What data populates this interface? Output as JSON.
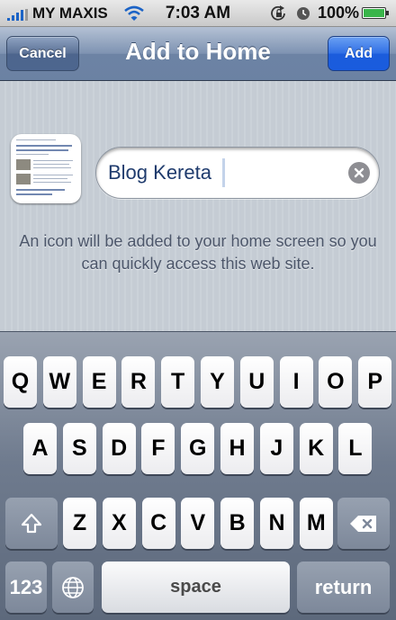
{
  "status_bar": {
    "carrier": "MY MAXIS",
    "time": "7:03 AM",
    "battery": "100%",
    "battery_level": 1.0
  },
  "nav": {
    "title": "Add to Home",
    "cancel_label": "Cancel",
    "add_label": "Add"
  },
  "form": {
    "name_value": "Blog Kereta",
    "hint": "An icon will be added to your home screen so you can quickly access this web site."
  },
  "keyboard": {
    "row1": [
      "Q",
      "W",
      "E",
      "R",
      "T",
      "Y",
      "U",
      "I",
      "O",
      "P"
    ],
    "row2": [
      "A",
      "S",
      "D",
      "F",
      "G",
      "H",
      "J",
      "K",
      "L"
    ],
    "row3": [
      "Z",
      "X",
      "C",
      "V",
      "B",
      "N",
      "M"
    ],
    "numbers_label": "123",
    "space_label": "space",
    "return_label": "return"
  },
  "colors": {
    "accent": "#1a5cde",
    "navbar": "#6d83a4",
    "battery": "#39b54a"
  },
  "icons": [
    "wifi-icon",
    "rotation-lock-icon",
    "alarm-icon",
    "battery-icon",
    "clear-icon",
    "shift-icon",
    "backspace-icon",
    "globe-icon"
  ]
}
